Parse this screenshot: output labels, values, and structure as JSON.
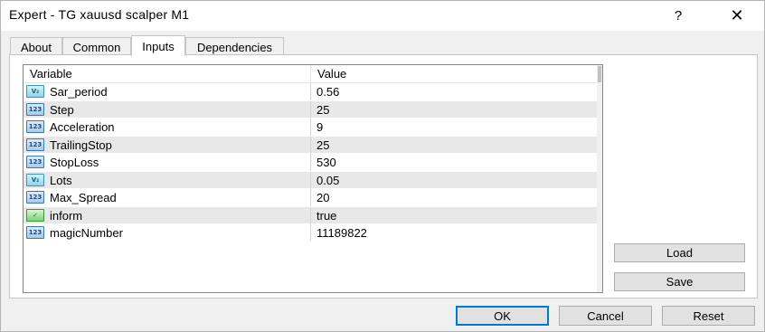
{
  "window": {
    "title": "Expert - TG xauusd scalper M1",
    "help_label": "?",
    "close_label": "✕"
  },
  "tabs": [
    {
      "label": "About",
      "active": false
    },
    {
      "label": "Common",
      "active": false
    },
    {
      "label": "Inputs",
      "active": true
    },
    {
      "label": "Dependencies",
      "active": false
    }
  ],
  "grid": {
    "headers": {
      "variable": "Variable",
      "value": "Value"
    },
    "rows": [
      {
        "type": "double",
        "icon": "double-type-icon",
        "icon_text": "V₂",
        "variable": "Sar_period",
        "value": "0.56"
      },
      {
        "type": "int",
        "icon": "integer-type-icon",
        "icon_text": "123",
        "variable": "Step",
        "value": "25"
      },
      {
        "type": "int",
        "icon": "integer-type-icon",
        "icon_text": "123",
        "variable": "Acceleration",
        "value": "9"
      },
      {
        "type": "int",
        "icon": "integer-type-icon",
        "icon_text": "123",
        "variable": "TrailingStop",
        "value": "25"
      },
      {
        "type": "int",
        "icon": "integer-type-icon",
        "icon_text": "123",
        "variable": "StopLoss",
        "value": "530"
      },
      {
        "type": "double",
        "icon": "double-type-icon",
        "icon_text": "V₂",
        "variable": "Lots",
        "value": "0.05"
      },
      {
        "type": "int",
        "icon": "integer-type-icon",
        "icon_text": "123",
        "variable": "Max_Spread",
        "value": "20"
      },
      {
        "type": "bool",
        "icon": "boolean-type-icon",
        "icon_text": "✓",
        "variable": "inform",
        "value": "true"
      },
      {
        "type": "int",
        "icon": "integer-type-icon",
        "icon_text": "123",
        "variable": "magicNumber",
        "value": "11189822"
      }
    ]
  },
  "buttons": {
    "load": "Load",
    "save": "Save",
    "ok": "OK",
    "cancel": "Cancel",
    "reset": "Reset"
  },
  "colors": {
    "focus_border": "#0078d7",
    "alt_row": "#e8e8e8"
  }
}
